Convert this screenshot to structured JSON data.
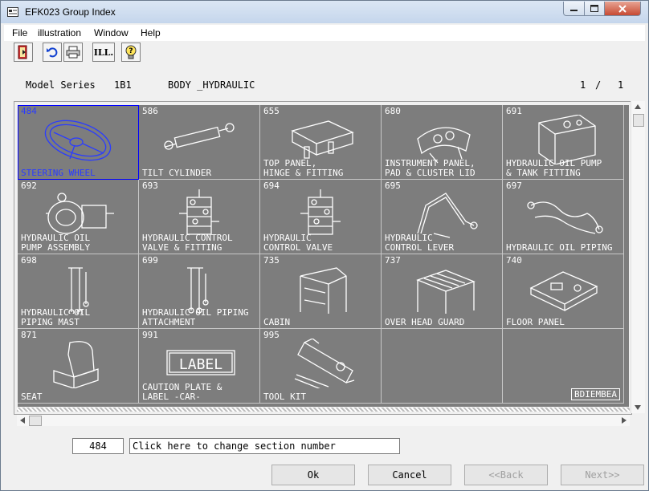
{
  "window": {
    "title": "EFK023 Group Index"
  },
  "menu": [
    "File",
    "illustration",
    "Window",
    "Help"
  ],
  "toolbar": {
    "illus_label": "ILL."
  },
  "header": {
    "model_label": "Model Series",
    "model_value": "1B1",
    "group_label": "BODY _HYDRAULIC",
    "page": "1",
    "page_sep": "/",
    "page_total": "1"
  },
  "cells": [
    {
      "num": "484",
      "label": "STEERING WHEEL",
      "icon": "steering-wheel-icon",
      "selected": true
    },
    {
      "num": "586",
      "label": "TILT CYLINDER",
      "icon": "tilt-cylinder-icon"
    },
    {
      "num": "655",
      "label": "TOP PANEL,\nHINGE & FITTING",
      "icon": "top-panel-icon"
    },
    {
      "num": "680",
      "label": "INSTRUMENT PANEL,\nPAD & CLUSTER LID",
      "icon": "instrument-panel-icon"
    },
    {
      "num": "691",
      "label": "HYDRAULIC OIL PUMP\n& TANK FITTING",
      "icon": "oil-tank-icon"
    },
    {
      "num": "692",
      "label": "HYDRAULIC OIL\nPUMP ASSEMBLY",
      "icon": "pump-icon"
    },
    {
      "num": "693",
      "label": "HYDRAULIC CONTROL\nVALVE & FITTING",
      "icon": "control-valve-icon"
    },
    {
      "num": "694",
      "label": "HYDRAULIC\nCONTROL VALVE",
      "icon": "control-valve-icon"
    },
    {
      "num": "695",
      "label": "HYDRAULIC\nCONTROL LEVER",
      "icon": "control-lever-icon"
    },
    {
      "num": "697",
      "label": "HYDRAULIC OIL PIPING",
      "icon": "piping-icon"
    },
    {
      "num": "698",
      "label": "HYDRAULIC OIL\nPIPING MAST",
      "icon": "piping-mast-icon"
    },
    {
      "num": "699",
      "label": "HYDRAULIC OIL PIPING\nATTACHMENT",
      "icon": "piping-attachment-icon"
    },
    {
      "num": "735",
      "label": "CABIN",
      "icon": "cabin-icon"
    },
    {
      "num": "737",
      "label": "OVER HEAD GUARD",
      "icon": "overhead-guard-icon"
    },
    {
      "num": "740",
      "label": "FLOOR PANEL",
      "icon": "floor-panel-icon"
    },
    {
      "num": "871",
      "label": "SEAT",
      "icon": "seat-icon"
    },
    {
      "num": "991",
      "label": "CAUTION PLATE &\nLABEL -CAR-",
      "icon": "label-plate-icon",
      "art_text": "LABEL"
    },
    {
      "num": "995",
      "label": "TOOL KIT",
      "icon": "tool-kit-icon"
    },
    {
      "num": "",
      "label": "",
      "icon": ""
    },
    {
      "num": "",
      "label": "",
      "icon": "",
      "tag": "BDIEMBEA"
    }
  ],
  "section_input": {
    "value": "484"
  },
  "hint_input": {
    "value": "Click here to change section number"
  },
  "buttons": {
    "ok": "Ok",
    "cancel": "Cancel",
    "back": "<<Back",
    "next": "Next>>"
  }
}
